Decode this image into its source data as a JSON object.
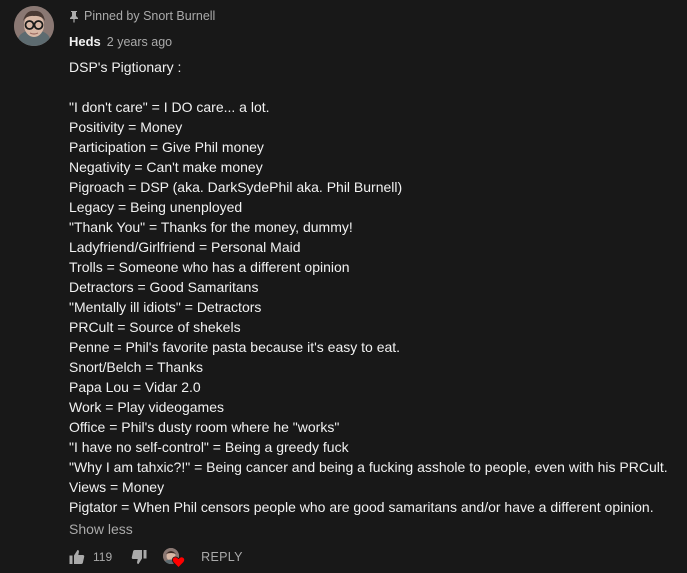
{
  "comment": {
    "pinned_text": "Pinned by Snort Burnell",
    "author": "Heds",
    "timestamp": "2 years ago",
    "lines": [
      "DSP's Pigtionary :",
      "",
      "\"I don't care\" = I DO care... a lot.",
      "Positivity = Money",
      "Participation = Give Phil money",
      "Negativity = Can't make money",
      "Pigroach = DSP (aka. DarkSydePhil aka. Phil Burnell)",
      "Legacy = Being unenployed",
      "\"Thank You\" = Thanks for the money, dummy!",
      "Ladyfriend/Girlfriend = Personal Maid",
      "Trolls = Someone who has a different opinion",
      "Detractors = Good Samaritans",
      "\"Mentally ill idiots\" = Detractors",
      "PRCult = Source of shekels",
      "Penne = Phil's favorite pasta because it's easy to eat.",
      "Snort/Belch = Thanks",
      "Papa Lou = Vidar 2.0",
      "Work = Play videogames",
      "Office = Phil's dusty room where he \"works\"",
      "\"I have no self-control\" = Being a greedy fuck",
      "\"Why I am tahxic?!\" = Being cancer and being a fucking asshole to people, even with his PRCult.",
      "Views = Money",
      "Pigtator = When Phil censors people who are good samaritans and/or have a different opinion."
    ],
    "show_less_label": "Show less",
    "like_count": "119",
    "reply_label": "REPLY"
  },
  "icons": {
    "pin": "pin-icon",
    "like": "thumbs-up-icon",
    "dislike": "thumbs-down-icon",
    "heart": "heart-icon"
  },
  "colors": {
    "background": "#181818",
    "text": "#f1f1f1",
    "secondary_text": "#aaaaaa",
    "heart": "#ff0000"
  }
}
